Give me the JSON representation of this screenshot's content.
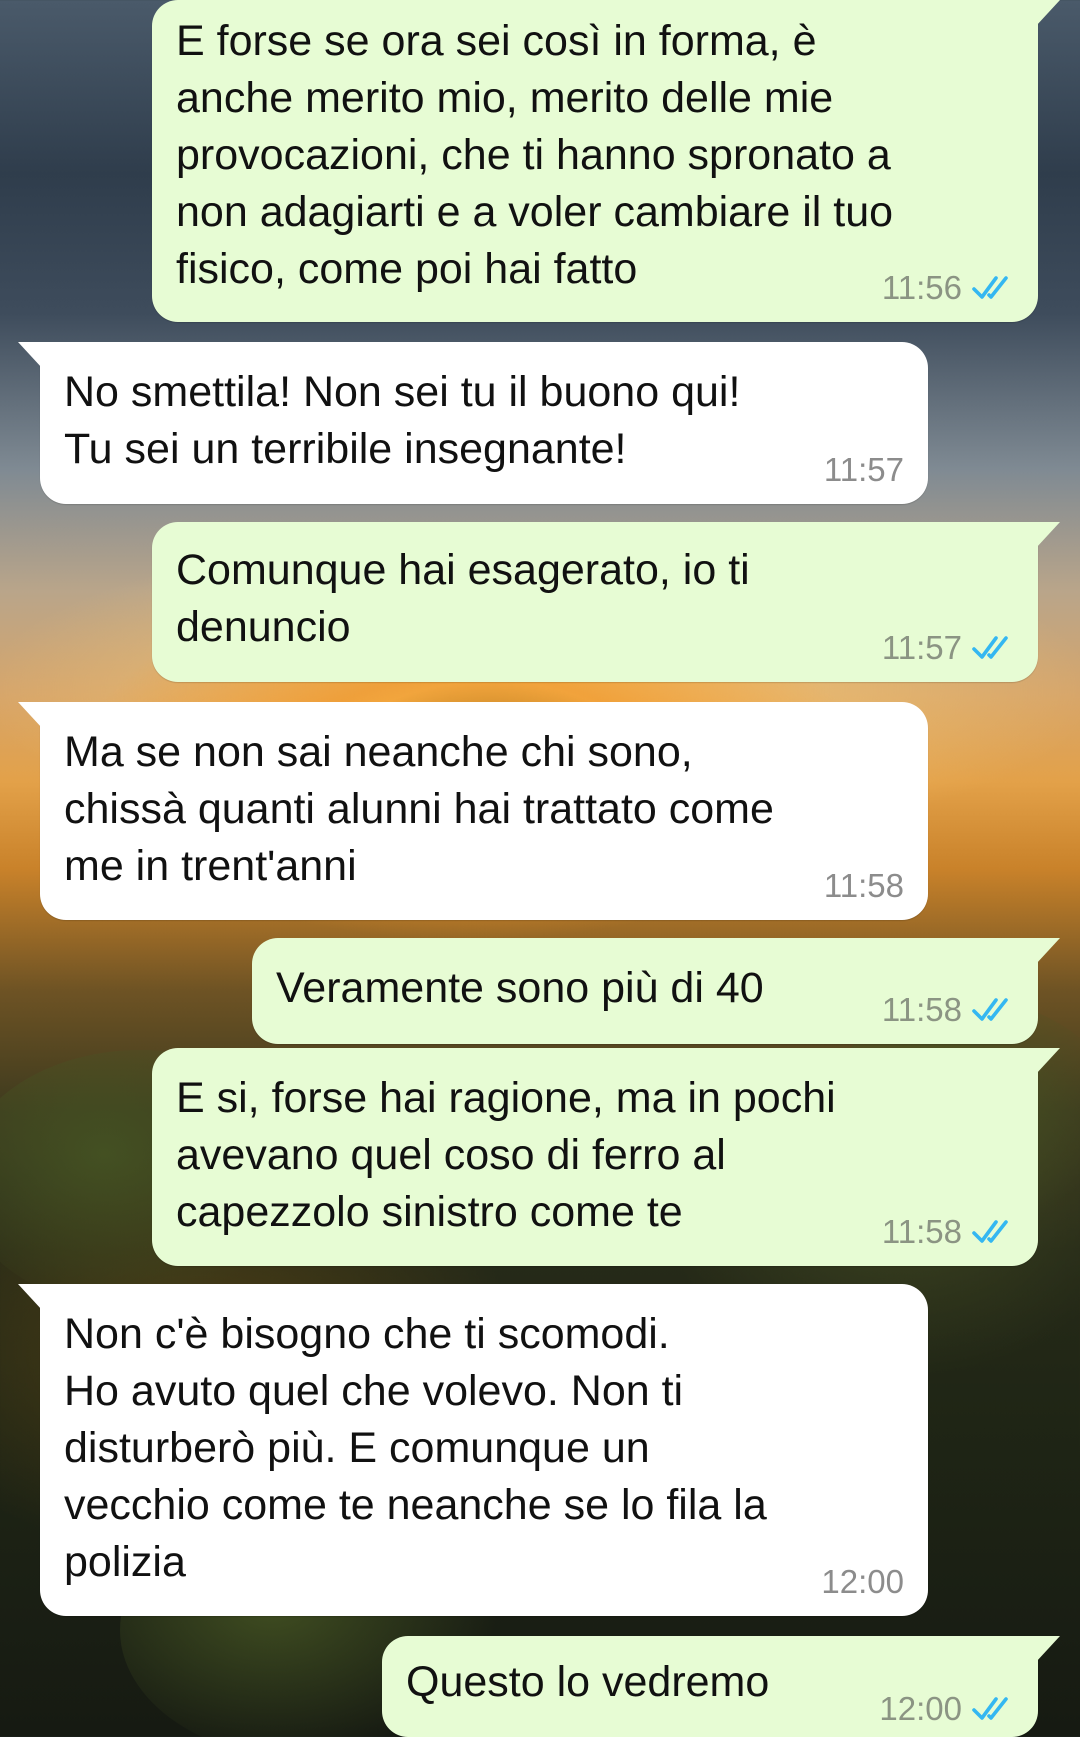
{
  "messages": [
    {
      "direction": "outgoing",
      "text": "E forse se ora sei così in forma, è\nanche merito mio, merito delle mie\nprovocazioni, che ti hanno spronato a\nnon adagiarti e a voler cambiare il tuo\nfisico, come poi hai fatto",
      "time": "11:56",
      "status": "read"
    },
    {
      "direction": "incoming",
      "text": "No smettila! Non sei tu il buono qui!\nTu sei un terribile insegnante!",
      "time": "11:57"
    },
    {
      "direction": "outgoing",
      "text": "Comunque hai esagerato, io ti\ndenuncio",
      "time": "11:57",
      "status": "read"
    },
    {
      "direction": "incoming",
      "text": "Ma se non sai neanche chi sono,\nchissà quanti alunni hai trattato come\nme in trent'anni",
      "time": "11:58"
    },
    {
      "direction": "outgoing",
      "text": "Veramente sono più di 40",
      "time": "11:58",
      "status": "read"
    },
    {
      "direction": "outgoing",
      "text": "E si, forse hai ragione, ma in pochi\navevano quel coso di ferro al\ncapezzolo sinistro come te",
      "time": "11:58",
      "status": "read"
    },
    {
      "direction": "incoming",
      "text": "Non c'è bisogno che ti scomodi.\nHo avuto quel che volevo. Non ti\ndisturberò più. E comunque un\nvecchio come te neanche se lo fila la\npolizia",
      "time": "12:00"
    },
    {
      "direction": "outgoing",
      "text": "Questo lo vedremo",
      "time": "12:00",
      "status": "read"
    }
  ],
  "colors": {
    "outgoing_bubble": "#e7fcd4",
    "incoming_bubble": "#ffffff",
    "read_ticks": "#34b7f1",
    "timestamp": "#8b9483"
  },
  "icons": {
    "read_receipt": "double-check-icon"
  }
}
